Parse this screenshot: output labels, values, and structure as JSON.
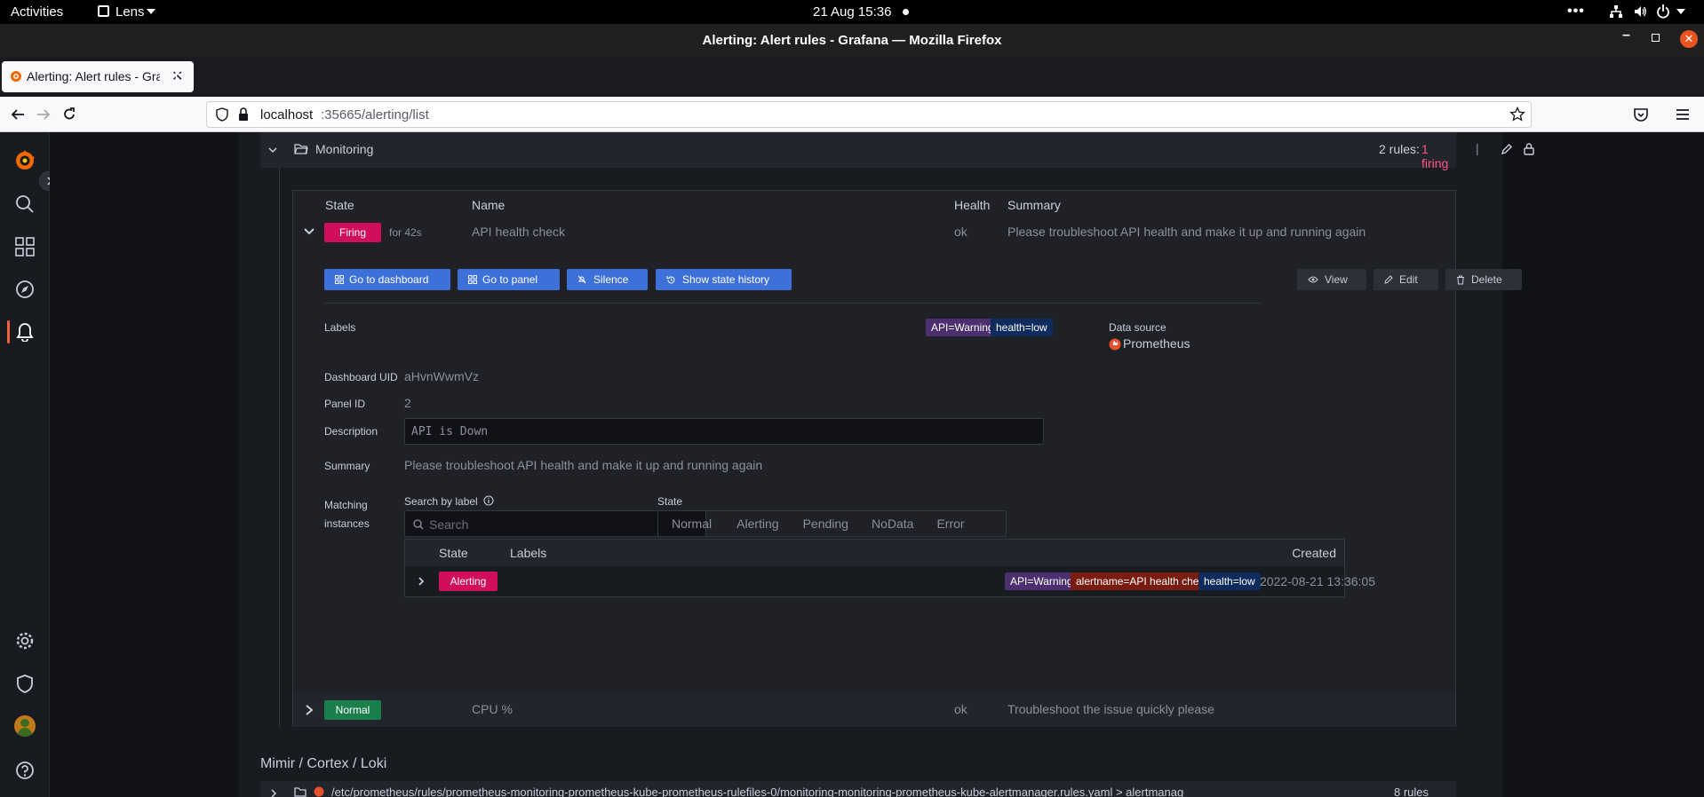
{
  "system_bar": {
    "activities": "Activities",
    "app_name": "Lens",
    "clock": "21 Aug  15:36"
  },
  "window": {
    "title": "Alerting: Alert rules - Grafana — Mozilla Firefox"
  },
  "browser": {
    "tab_title": "Alerting: Alert rules - Grafa",
    "url_host": "localhost",
    "url_rest": ":35665/alerting/list"
  },
  "group": {
    "name": "Monitoring",
    "rules_count": "2 rules:",
    "firing_count": "1 firing",
    "separator": "|"
  },
  "rules_table": {
    "headers": {
      "state": "State",
      "name": "Name",
      "health": "Health",
      "summary": "Summary"
    },
    "rows": [
      {
        "state": "Firing",
        "duration": "for 42s",
        "name": "API health check",
        "health": "ok",
        "summary": "Please troubleshoot API health and make it up and running again"
      },
      {
        "state": "Normal",
        "name": "CPU %",
        "health": "ok",
        "summary": "Troubleshoot the issue quickly please"
      }
    ]
  },
  "actions": {
    "go_to_dashboard": "Go to dashboard",
    "go_to_panel": "Go to panel",
    "silence": "Silence",
    "show_state_history": "Show state history",
    "view": "View",
    "edit": "Edit",
    "delete": "Delete"
  },
  "details": {
    "labels_title": "Labels",
    "labels": [
      "API=Warning",
      "health=low"
    ],
    "datasource_title": "Data source",
    "datasource": "Prometheus",
    "dashboard_uid_label": "Dashboard UID",
    "dashboard_uid": "aHvnWwmVz",
    "panel_id_label": "Panel ID",
    "panel_id": "2",
    "description_label": "Description",
    "description": "API is Down",
    "summary_label": "Summary",
    "summary": "Please troubleshoot API health and make it up and running again"
  },
  "instances": {
    "title_line1": "Matching",
    "title_line2": "instances",
    "search_label": "Search by label",
    "search_placeholder": "Search",
    "state_label": "State",
    "state_filters": [
      "Normal",
      "Alerting",
      "Pending",
      "NoData",
      "Error"
    ],
    "headers": {
      "state": "State",
      "labels": "Labels",
      "created": "Created"
    },
    "row": {
      "state": "Alerting",
      "labels": [
        "API=Warning",
        "alertname=API health check",
        "health=low"
      ],
      "created": "2022-08-21 13:36:05"
    }
  },
  "section2": {
    "title": "Mimir / Cortex / Loki",
    "first_file": "/etc/prometheus/rules/prometheus-monitoring-prometheus-kube-prometheus-rulefiles-0/monitoring-monitoring-prometheus-kube-alertmanager.rules.yaml > alertmanager.rules",
    "first_count": "8 rules"
  },
  "colors": {
    "firing": "#d10e5c",
    "normal": "#1a7f4b",
    "primary": "#3d71d9",
    "tag_purple": "#4b2f6e",
    "tag_navy": "#0d2b5c",
    "tag_maroon": "#7a1b10"
  }
}
